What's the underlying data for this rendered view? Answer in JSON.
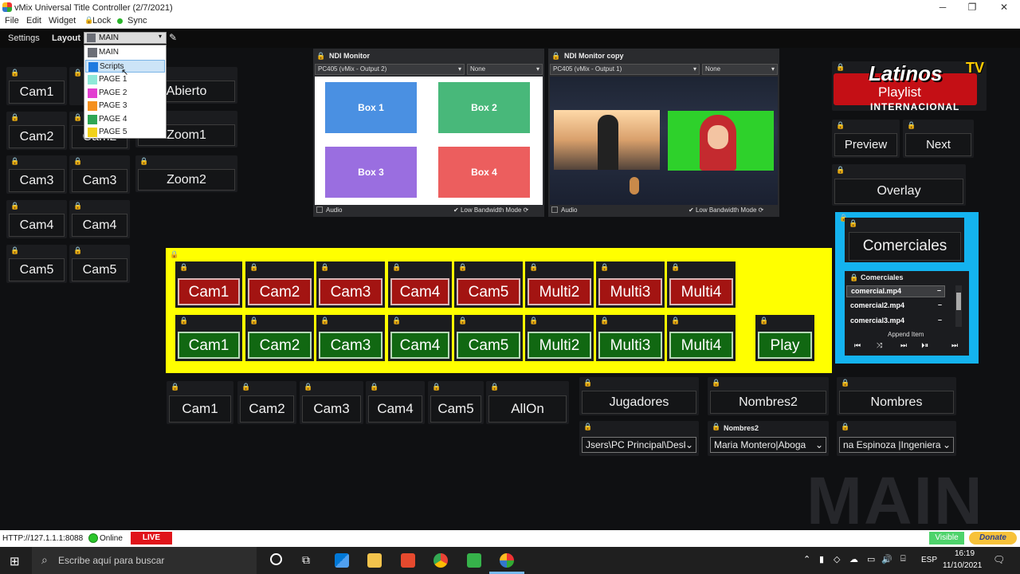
{
  "window": {
    "title": "vMix Universal Title Controller (2/7/2021)",
    "minimize": "─",
    "maximize": "❐",
    "close": "✕"
  },
  "menu": {
    "file": "File",
    "edit": "Edit",
    "widget": "Widget",
    "lock": "Lock",
    "sync": "Sync"
  },
  "toolbar": {
    "settings": "Settings",
    "layout": "Layout",
    "selected": "MAIN"
  },
  "layout_options": [
    {
      "label": "MAIN",
      "color": "#6b6e76"
    },
    {
      "label": "Scripts",
      "color": "#1e7be0"
    },
    {
      "label": "PAGE 1",
      "color": "#8ee8d8"
    },
    {
      "label": "PAGE 2",
      "color": "#e23fd0"
    },
    {
      "label": "PAGE 3",
      "color": "#f5901e"
    },
    {
      "label": "PAGE 4",
      "color": "#2ea654"
    },
    {
      "label": "PAGE 5",
      "color": "#f1d21a"
    }
  ],
  "left_col1": [
    "Cam1",
    "Cam2",
    "Cam3",
    "Cam4",
    "Cam5"
  ],
  "left_col2": [
    "Cam2",
    "Cam3",
    "Cam4",
    "Cam5"
  ],
  "left_col3": [
    "Abierto",
    "Zoom1",
    "Zoom2"
  ],
  "monitor1": {
    "title": "NDI Monitor",
    "source": "PC405 (vMix - Output 2)",
    "second": "None",
    "boxes": [
      "Box 1",
      "Box 2",
      "Box 3",
      "Box 4"
    ],
    "audio": "Audio",
    "lowbw": "Low Bandwidth Mode"
  },
  "monitor2": {
    "title": "NDI Monitor copy",
    "source": "PC405 (vMix - Output 1)",
    "second": "None",
    "audio": "Audio",
    "lowbw": "Low Bandwidth Mode"
  },
  "logo": {
    "line1": "Latinos",
    "line2": "TV",
    "line3": "Playlist",
    "line4": "INTERNACIONAL"
  },
  "right_buttons": {
    "preview": "Preview",
    "next": "Next",
    "overlay": "Overlay",
    "comerciales": "Comerciales"
  },
  "playlist": {
    "title": "Comerciales",
    "items": [
      "comercial.mp4",
      "comercial2.mp4",
      "comercial3.mp4"
    ],
    "append": "Append Item"
  },
  "red_row": [
    "Cam1",
    "Cam2",
    "Cam3",
    "Cam4",
    "Cam5",
    "Multi2",
    "Multi3",
    "Multi4"
  ],
  "green_row": [
    "Cam1",
    "Cam2",
    "Cam3",
    "Cam4",
    "Cam5",
    "Multi2",
    "Multi3",
    "Multi4"
  ],
  "play": "Play",
  "bottom_row": [
    "Cam1",
    "Cam2",
    "Cam3",
    "Cam4",
    "Cam5",
    "AllOn"
  ],
  "titles_buttons": [
    "Jugadores",
    "Nombres2",
    "Nombres"
  ],
  "title_fields": [
    {
      "label": "",
      "value": "Jsers\\PC Principal\\Desk"
    },
    {
      "label": "Nombres2",
      "value": "Maria Montero|Aboga"
    },
    {
      "label": "",
      "value": "na Espinoza |Ingeniera"
    }
  ],
  "watermark": "MAIN",
  "status": {
    "http": "HTTP://127.1.1.1:8088",
    "online": "Online",
    "live": "LIVE",
    "visible": "Visible",
    "donate": "Donate"
  },
  "taskbar": {
    "search": "Escribe aquí para buscar",
    "lang": "ESP",
    "time": "16:19",
    "date": "11/10/2021"
  }
}
